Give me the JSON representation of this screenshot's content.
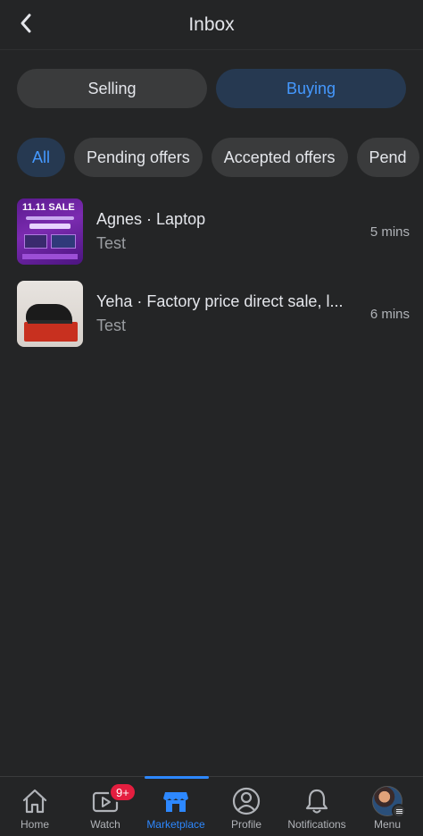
{
  "header": {
    "title": "Inbox"
  },
  "segments": {
    "selling": "Selling",
    "buying": "Buying"
  },
  "filters": [
    "All",
    "Pending offers",
    "Accepted offers",
    "Pend"
  ],
  "conversations": [
    {
      "title": "Agnes · Laptop",
      "subtitle": "Test",
      "time": "5 mins",
      "thumb_text": "11.11 SALE"
    },
    {
      "title": "Yeha · Factory price direct sale, l...",
      "subtitle": "Test",
      "time": "6 mins"
    }
  ],
  "nav": {
    "home": "Home",
    "watch": "Watch",
    "watch_badge": "9+",
    "marketplace": "Marketplace",
    "profile": "Profile",
    "notifications": "Notifications",
    "menu": "Menu"
  },
  "colors": {
    "accent": "#2d88ff",
    "badge": "#e41e3f",
    "background": "#242526"
  }
}
